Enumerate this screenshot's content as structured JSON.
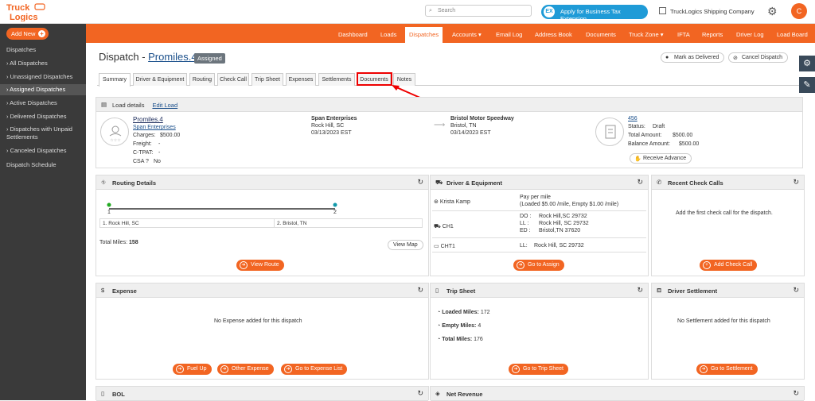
{
  "brand": {
    "line1": "Truck",
    "line2": "Logics",
    "color": "#f26522"
  },
  "topbar": {
    "search_placeholder": "Search",
    "tax_button": "Apply for Business Tax Extension",
    "company": "TruckLogics Shipping Company",
    "avatar": "C"
  },
  "sidebar": {
    "add_new": "Add New",
    "section": "Dispatches",
    "items": [
      "All Dispatches",
      "Unassigned Dispatches",
      "Assigned Dispatches",
      "Active Dispatches",
      "Delivered Dispatches",
      "Dispatches with Unpaid Settlements",
      "Canceled Dispatches"
    ],
    "schedule": "Dispatch Schedule"
  },
  "nav": [
    "Dashboard",
    "Loads",
    "Dispatches",
    "Accounts",
    "Email Log",
    "Address Book",
    "Documents",
    "Truck Zone",
    "IFTA",
    "Reports",
    "Driver Log",
    "Load Board"
  ],
  "page": {
    "title_prefix": "Dispatch - ",
    "title_link": "Promiles.4",
    "status": "Assigned",
    "mark_delivered": "Mark as Delivered",
    "cancel": "Cancel Dispatch"
  },
  "tabs": [
    "Summary",
    "Driver & Equipment",
    "Routing",
    "Check Call",
    "Trip Sheet",
    "Expenses",
    "Settlements",
    "Documents",
    "Notes"
  ],
  "load": {
    "header": "Load details",
    "edit": "Edit Load",
    "name": "Promiles.4",
    "customer": "Span Enterprises",
    "charges_label": "Charges:",
    "charges": "$500.00",
    "freight_label": "Freight:",
    "freight": "-",
    "ctpat_label": "C-TPAT:",
    "ctpat": "-",
    "csa_label": "CSA ?",
    "csa": "No",
    "pickup_name": "Span Enterprises",
    "pickup_city": "Rock Hill, SC",
    "pickup_date": "03/13/2023 EST",
    "drop_name": "Bristol Motor Speedway",
    "drop_city": "Bristol, TN",
    "drop_date": "03/14/2023 EST",
    "invoice": "456",
    "status_label": "Status:",
    "status": "Draft",
    "total_label": "Total Amount:",
    "total": "$500.00",
    "balance_label": "Balance Amount:",
    "balance": "$500.00",
    "advance": "Receive Advance"
  },
  "routing": {
    "header": "Routing Details",
    "stop1": "1",
    "stop2": "2",
    "addr1": "1. Rock Hill, SC",
    "addr2": "2. Bristol, TN",
    "miles_label": "Total Miles:",
    "miles": "158",
    "view_map": "View Map",
    "view_route": "View Route"
  },
  "driver": {
    "header": "Driver & Equipment",
    "name": "Krista Kamp",
    "pay": "Pay per mile",
    "pay_detail": "(Loaded $5.00 /mile, Empty $1.00 /mile)",
    "truck": "CH1",
    "do_label": "DO :",
    "do": "Rock Hill,SC 29732",
    "ll_label": "LL :",
    "ll": "Rock Hill, SC 29732",
    "ed_label": "ED :",
    "ed": "Bristol,TN 37620",
    "trailer": "CHT1",
    "ll2_label": "LL:",
    "ll2": "Rock Hill, SC 29732",
    "assign": "Go to Assign"
  },
  "checkcalls": {
    "header": "Recent Check Calls",
    "empty": "Add the first check call for the dispatch.",
    "add": "Add Check Call"
  },
  "expense": {
    "header": "Expense",
    "empty": "No Expense added for this dispatch",
    "fuel": "Fuel Up",
    "other": "Other Expense",
    "list": "Go to Expense List"
  },
  "trip": {
    "header": "Trip Sheet",
    "loaded_label": "Loaded Miles:",
    "loaded": "172",
    "empty_label": "Empty Miles:",
    "empty": "4",
    "total_label": "Total Miles:",
    "total": "176",
    "go": "Go to Trip Sheet"
  },
  "settlement": {
    "header": "Driver Settlement",
    "empty": "No Settlement added for this dispatch",
    "go": "Go to Settlement"
  },
  "bol": {
    "header": "BOL"
  },
  "revenue": {
    "header": "Net Revenue"
  }
}
